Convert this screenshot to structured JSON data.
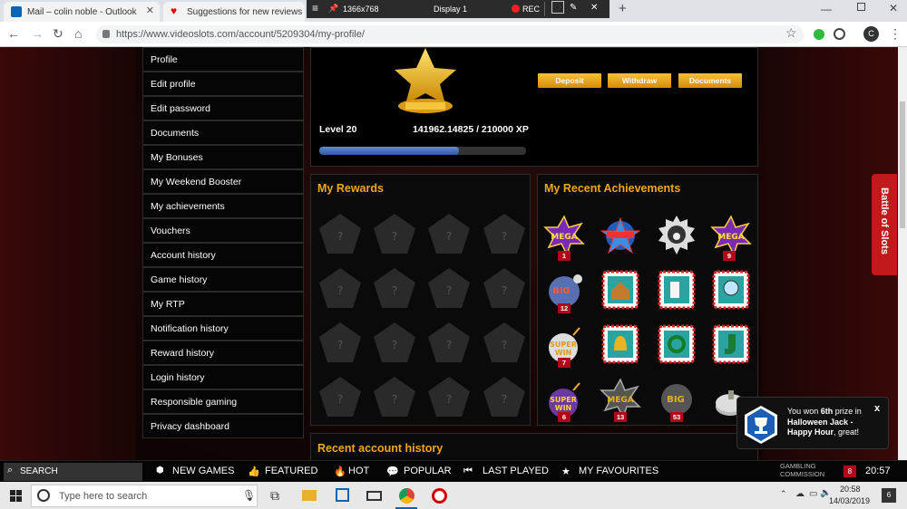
{
  "browser": {
    "tabs": [
      {
        "title": "Mail – colin noble - Outlook"
      },
      {
        "title": "Suggestions for new reviews | F"
      }
    ],
    "overlay": {
      "resolution": "1366x768",
      "display": "Display 1",
      "rec": "REC"
    },
    "url": "https://www.videoslots.com/account/5209304/my-profile/",
    "profile_initial": "C"
  },
  "menu": {
    "items": [
      {
        "label": "Profile"
      },
      {
        "label": "Edit profile"
      },
      {
        "label": "Edit password"
      },
      {
        "label": "Documents"
      },
      {
        "label": "My Bonuses"
      },
      {
        "label": "My Weekend Booster"
      },
      {
        "label": "My achievements"
      },
      {
        "label": "Vouchers"
      },
      {
        "label": "Account history"
      },
      {
        "label": "Game history"
      },
      {
        "label": "My RTP"
      },
      {
        "label": "Notification history"
      },
      {
        "label": "Reward history"
      },
      {
        "label": "Login history"
      },
      {
        "label": "Responsible gaming"
      },
      {
        "label": "Privacy dashboard"
      }
    ]
  },
  "profile": {
    "level": "Level 20",
    "xp": "141962.14825 / 210000 XP",
    "xp_fraction": 0.676,
    "buttons": {
      "deposit": "Deposit",
      "withdraw": "Withdraw",
      "documents": "Documents"
    }
  },
  "rewards": {
    "title": "My Rewards",
    "placeholder": "?"
  },
  "achievements": {
    "title": "My Recent Achievements",
    "badges": [
      "1",
      "9",
      "12",
      "7",
      "6",
      "13",
      "53"
    ]
  },
  "recent": {
    "title": "Recent account history"
  },
  "side_tab": "Battle of Slots",
  "notification": {
    "pre": "You won ",
    "prize": "6th",
    "mid": " prize in ",
    "game": "Halloween Jack - Happy Hour",
    "post": ", great!",
    "close": "x"
  },
  "sitebar": {
    "search": "SEARCH",
    "new_games": "NEW GAMES",
    "featured": "FEATURED",
    "hot": "HOT",
    "popular": "POPULAR",
    "last_played": "LAST PLAYED",
    "favourites": "MY FAVOURITES",
    "gambling_1": "GAMBLING",
    "gambling_2": "COMMISSION",
    "count": "8",
    "time": "20:57"
  },
  "taskbar": {
    "search_placeholder": "Type here to search",
    "time": "20:58",
    "date": "14/03/2019",
    "notif_count": "6"
  },
  "colors": {
    "gold": "#f0a818",
    "badge_red": "#b2071b",
    "xp_blue": "#3e6fb4"
  }
}
